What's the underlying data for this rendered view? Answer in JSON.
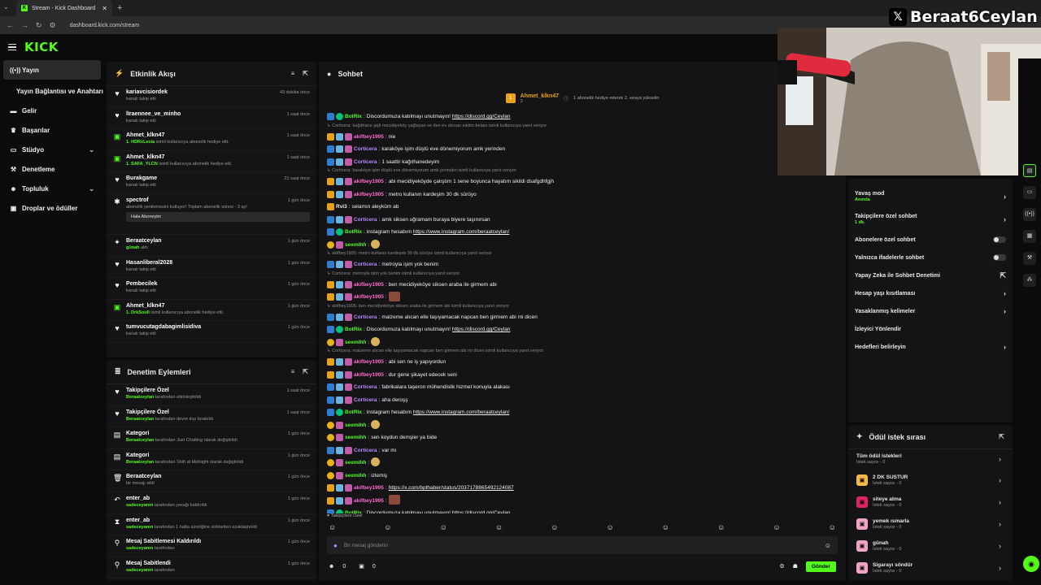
{
  "browser": {
    "tab_title": "Stream - Kick Dashboard",
    "url": "dashboard.kick.com/stream"
  },
  "brand": {
    "logo": "KICK",
    "accent": "#53fc18"
  },
  "overlay": {
    "x_handle": "Beraat6Ceylan"
  },
  "sidebar": {
    "items": [
      {
        "label": "Yayın",
        "icon": "broadcast-icon"
      },
      {
        "label": "Yayın Bağlantısı ve Anahtarı",
        "icon": ""
      },
      {
        "label": "Gelir",
        "icon": "money-icon"
      },
      {
        "label": "Başarılar",
        "icon": "trophy-icon"
      },
      {
        "label": "Stüdyo",
        "icon": "monitor-icon"
      },
      {
        "label": "Denetleme",
        "icon": "hammer-icon"
      },
      {
        "label": "Topluluk",
        "icon": "users-icon"
      },
      {
        "label": "Droplar ve ödüller",
        "icon": "gift-icon"
      }
    ]
  },
  "activity": {
    "title": "Etkinlik Akışı",
    "items": [
      {
        "name": "kariavcisiordek",
        "sub": "kanalı takip etti",
        "time": "43 dakika önce",
        "icon": "heart"
      },
      {
        "name": "lIraennee_ve_minho",
        "sub": "kanalı takip etti",
        "time": "1 saat önce",
        "icon": "heart"
      },
      {
        "name": "Ahmet_klkn47",
        "sub_user": "1. HDRxLexia",
        "sub": "isimli kullanıcıya abonelik hediye etti.",
        "time": "1 saat önce",
        "icon": "gift"
      },
      {
        "name": "Ahmet_klkn47",
        "sub_user": "1. SAFA_YLCN",
        "sub": "isimli kullanıcıya abonelik hediye etti.",
        "time": "1 saat önce",
        "icon": "gift"
      },
      {
        "name": "Burakgame",
        "sub": "kanalı takip etti",
        "time": "21 saat önce",
        "icon": "heart"
      },
      {
        "name": "spectrof",
        "sub": "abonelik yenilemesini kutluyor! Toplam abonelik süresi - 3 ay!",
        "time": "1 gün önce",
        "icon": "star",
        "button": "Hala Aboneyim"
      },
      {
        "name": "Beraatceylan",
        "sub_user": "günah",
        "sub": "aldı",
        "time": "1 gün önce",
        "icon": "reward"
      },
      {
        "name": "Hasanliberal2028",
        "sub": "kanalı takip etti",
        "time": "1 gün önce",
        "icon": "heart"
      },
      {
        "name": "Pembecilek",
        "sub": "kanalı takip etti",
        "time": "1 gün önce",
        "icon": "heart"
      },
      {
        "name": "Ahmet_klkn47",
        "sub_user": "1. DrkSoull",
        "sub": "isimli kullanıcıya abonelik hediye etti.",
        "time": "1 gün önce",
        "icon": "gift"
      },
      {
        "name": "tumvucutagdabagimlisidiva",
        "sub": "kanalı takip etti",
        "time": "1 gün önce",
        "icon": "heart"
      }
    ]
  },
  "moderation": {
    "title": "Denetim Eylemleri",
    "items": [
      {
        "name": "Takipçilere Özel",
        "sub_user": "Beraatceylan",
        "sub": "tarafından etkinleştirildi",
        "time": "1 saat önce",
        "icon": "heart"
      },
      {
        "name": "Takipçilere Özel",
        "sub_user": "Beraatceylan",
        "sub": "tarafından devre dışı bırakıldı",
        "time": "1 saat önce",
        "icon": "heart"
      },
      {
        "name": "Kategori",
        "sub_user": "Beraatceylan",
        "sub": "tarafından Just Chatting olarak değiştirildi",
        "time": "1 gün önce",
        "icon": "category"
      },
      {
        "name": "Kategori",
        "sub_user": "Beraatceylan",
        "sub": "tarafından Shift at Midnight olarak değiştirildi",
        "time": "1 gün önce",
        "icon": "category"
      },
      {
        "name": "Beraatceylan",
        "sub": "bir mesajı sildi",
        "time": "1 gün önce",
        "icon": "trash"
      },
      {
        "name": "enter_ab",
        "sub_user": "sadeceyaren",
        "sub": "tarafından yasağı kaldırıldı",
        "time": "1 gün önce",
        "icon": "undo"
      },
      {
        "name": "enter_ab",
        "sub_user": "sadeceyaren",
        "sub": "tarafından 1 hafta süreliğine sohbetten uzaklaştırıldı",
        "time": "1 gün önce",
        "icon": "hourglass"
      },
      {
        "name": "Mesaj Sabitlemesi Kaldırıldı",
        "sub_user": "sadeceyaren",
        "sub": "tarafından",
        "time": "1 gün önce",
        "icon": "pin"
      },
      {
        "name": "Mesaj Sabitlendi",
        "sub_user": "sadeceyaren",
        "sub": "tarafından",
        "time": "1 gün önce",
        "icon": "pin"
      }
    ]
  },
  "chat": {
    "title": "Sohbet",
    "gift_banner": {
      "user": "Ahmet_klkn47",
      "count": "3",
      "text": "1 abonelik hediye ederek 2. sıraya yükselin"
    },
    "messages": [
      {
        "type": "msg",
        "badges": [
          "b-blue",
          "b-green"
        ],
        "user": "BotRix",
        "ucls": "u-green",
        "text": "Discordumuza katılmayı unutmayın!",
        "link": "https://discord.gg/Ceylan"
      },
      {
        "type": "reply",
        "text": "Corticera: kağıthane şişli mecidiyeköy çağlayan ve den ev alırsan sıktim belanı isimli kullanıcıya yanıt veriyor"
      },
      {
        "type": "msg",
        "badges": [
          "b-gold",
          "b-ice",
          "b-pink"
        ],
        "user": "akifbey1905",
        "ucls": "u-pink",
        "text": "nie"
      },
      {
        "type": "msg",
        "badges": [
          "b-blue",
          "b-ice",
          "b-pink"
        ],
        "user": "Corticera",
        "ucls": "u-violet",
        "text": "karaköye işim düştü eve dönemiyorum amk yerinden"
      },
      {
        "type": "msg",
        "badges": [
          "b-blue",
          "b-ice",
          "b-pink"
        ],
        "user": "Corticera",
        "ucls": "u-violet",
        "text": "1 saattir kağıthanedeyim"
      },
      {
        "type": "reply",
        "text": "Corticera: karaköye işim düştü eve dönemiyorum amk yerinden isimli kullanıcıya yanıt veriyor"
      },
      {
        "type": "msg",
        "badges": [
          "b-gold",
          "b-ice",
          "b-pink"
        ],
        "user": "akifbey1905",
        "ucls": "u-pink",
        "text": "abi mecidiyeköyde çalıştım 1 sene boyunca hayatım sikildi dsafgdhfgjh"
      },
      {
        "type": "msg",
        "badges": [
          "b-gold",
          "b-ice",
          "b-pink"
        ],
        "user": "akifbey1905",
        "ucls": "u-pink",
        "text": "metro kullanın kardeşim 30 dk sürüyo"
      },
      {
        "type": "msg",
        "badges": [
          "b-gold"
        ],
        "user": "Rvi3",
        "ucls": "",
        "text": "selamın aleyküm ab"
      },
      {
        "type": "msg",
        "badges": [
          "b-blue",
          "b-ice",
          "b-pink"
        ],
        "user": "Corticera",
        "ucls": "u-violet",
        "text": "amk siksen uğramam buraya biyere taşınırsan"
      },
      {
        "type": "msg",
        "badges": [
          "b-blue",
          "b-green"
        ],
        "user": "BotRix",
        "ucls": "u-green",
        "text": "instagram hesabım",
        "link": "https://www.instagram.com/beraatceylan/"
      },
      {
        "type": "msg",
        "badges": [
          "b-yellow",
          "b-pink"
        ],
        "user": "seemihh",
        "ucls": "u-green",
        "text": "",
        "emote": "emote"
      },
      {
        "type": "reply",
        "text": "akifbey1905: metro kullanın kardeşim 30 dk sürüyo isimli kullanıcıya yanıt veriyor"
      },
      {
        "type": "msg",
        "badges": [
          "b-blue",
          "b-ice",
          "b-pink"
        ],
        "user": "Corticera",
        "ucls": "u-violet",
        "text": "metroyla işim yok benim"
      },
      {
        "type": "reply",
        "text": "Corticera: metroyla işim yok benim isimli kullanıcıya yanıt veriyor"
      },
      {
        "type": "msg",
        "badges": [
          "b-gold",
          "b-ice",
          "b-pink"
        ],
        "user": "akifbey1905",
        "ucls": "u-pink",
        "text": "ben mecidiyeköye siksen araba ile girmem abi"
      },
      {
        "type": "msg",
        "badges": [
          "b-gold",
          "b-ice",
          "b-pink"
        ],
        "user": "akifbey1905",
        "ucls": "u-pink",
        "text": "",
        "emote": "img"
      },
      {
        "type": "reply",
        "text": "akifbey1905: ben mecidiyeköye siksen araba ile girmem abi isimli kullanıcıya yanıt veriyor"
      },
      {
        "type": "msg",
        "badges": [
          "b-blue",
          "b-ice",
          "b-pink"
        ],
        "user": "Corticera",
        "ucls": "u-violet",
        "text": "malzeme alıcan elle taşıyamacak napcan ben girmem abi mi dicen"
      },
      {
        "type": "msg",
        "badges": [
          "b-blue",
          "b-green"
        ],
        "user": "BotRix",
        "ucls": "u-green",
        "text": "Discordumuza katılmayı unutmayın!",
        "link": "https://discord.gg/Ceylan"
      },
      {
        "type": "msg",
        "badges": [
          "b-yellow",
          "b-pink"
        ],
        "user": "seemihh",
        "ucls": "u-green",
        "text": "",
        "emote": "emote"
      },
      {
        "type": "reply",
        "text": "Corticera: malzeme alıcan elle taşıyamacak napcan ben girmem abi mi dicen isimli kullanıcıya yanıt veriyor"
      },
      {
        "type": "msg",
        "badges": [
          "b-gold",
          "b-ice",
          "b-pink"
        ],
        "user": "akifbey1905",
        "ucls": "u-pink",
        "text": "abi sen ne iş yapıyordun"
      },
      {
        "type": "msg",
        "badges": [
          "b-gold",
          "b-ice",
          "b-pink"
        ],
        "user": "akifbey1905",
        "ucls": "u-pink",
        "text": "dur gene şikayet edecek seni"
      },
      {
        "type": "msg",
        "badges": [
          "b-blue",
          "b-ice",
          "b-pink"
        ],
        "user": "Corticera",
        "ucls": "u-violet",
        "text": "fabrikalara taşeron mühendislik hizmet konuyla alakası"
      },
      {
        "type": "msg",
        "badges": [
          "b-blue",
          "b-ice",
          "b-pink"
        ],
        "user": "Corticera",
        "ucls": "u-violet",
        "text": "aha deroşş"
      },
      {
        "type": "msg",
        "badges": [
          "b-blue",
          "b-green"
        ],
        "user": "BotRix",
        "ucls": "u-green",
        "text": "instagram hesabım",
        "link": "https://www.instagram.com/beraatceylan/"
      },
      {
        "type": "msg",
        "badges": [
          "b-yellow",
          "b-pink"
        ],
        "user": "seemihh",
        "ucls": "u-green",
        "text": "",
        "emote": "emote"
      },
      {
        "type": "msg",
        "badges": [
          "b-yellow",
          "b-pink"
        ],
        "user": "seemihh",
        "ucls": "u-green",
        "text": "sen koydun demşler ya bide"
      },
      {
        "type": "msg",
        "badges": [
          "b-blue",
          "b-ice",
          "b-pink"
        ],
        "user": "Corticera",
        "ucls": "u-violet",
        "text": "var mı"
      },
      {
        "type": "msg",
        "badges": [
          "b-yellow",
          "b-pink"
        ],
        "user": "seemihh",
        "ucls": "u-green",
        "text": "",
        "emote": "emote"
      },
      {
        "type": "msg",
        "badges": [
          "b-yellow",
          "b-pink"
        ],
        "user": "seemihh",
        "ucls": "u-green",
        "text": "izlemiş"
      },
      {
        "type": "msg",
        "badges": [
          "b-gold",
          "b-ice",
          "b-pink"
        ],
        "user": "akifbey1905",
        "ucls": "u-pink",
        "text": "",
        "link": "https://x.com/bpthaber/status/2037178865492124087"
      },
      {
        "type": "msg",
        "badges": [
          "b-gold",
          "b-ice",
          "b-pink"
        ],
        "user": "akifbey1905",
        "ucls": "u-pink",
        "text": "",
        "emote": "img"
      },
      {
        "type": "msg",
        "badges": [
          "b-blue",
          "b-green"
        ],
        "user": "BotRix",
        "ucls": "u-green",
        "text": "Discordumuza katılmayı unutmayın!",
        "link": "https://discord.gg/Ceylan"
      }
    ],
    "followers_only": "Takipçilere Özel",
    "input_placeholder": "Bir mesaj gönderin",
    "viewers": "0",
    "points": "0",
    "send": "Gönder"
  },
  "settings": {
    "items": [
      {
        "label": "Yavaş mod",
        "value": "Anında",
        "control": "chevron"
      },
      {
        "label": "Takipçilere özel sohbet",
        "value": "1 dk.",
        "control": "chevron"
      },
      {
        "label": "Abonelere özel sohbet",
        "value": "",
        "control": "toggle"
      },
      {
        "label": "Yalnızca ifadelerle sohbet",
        "value": "",
        "control": "toggle"
      },
      {
        "label": "Yapay Zeka ile Sohbet Denetimi",
        "value": "",
        "control": "external"
      },
      {
        "label": "Hesap yaşı kısıtlaması",
        "value": "",
        "control": "chevron"
      },
      {
        "label": "Yasaklanmış kelimeler",
        "value": "",
        "control": "chevron"
      },
      {
        "label": "İzleyici Yönlendir",
        "value": "",
        "control": "none"
      },
      {
        "label": "Hedefleri belirleyin",
        "value": "",
        "control": "chevron"
      }
    ]
  },
  "rewards": {
    "title": "Ödül istek sırası",
    "all": {
      "label": "Tüm ödül istekleri",
      "sub": "İstek sayısı - 0"
    },
    "items": [
      {
        "label": "2 DK SUSTUR",
        "sub": "İstek sayısı - 0",
        "color": "#f5b94a"
      },
      {
        "label": "siteye atma",
        "sub": "İstek sayısı - 0",
        "color": "#e0245e"
      },
      {
        "label": "yemek ısmarla",
        "sub": "İstek sayısı - 0",
        "color": "#f0a3c4"
      },
      {
        "label": "günah",
        "sub": "İstek sayısı - 0",
        "color": "#f0a3c4"
      },
      {
        "label": "Sigarayı söndür",
        "sub": "İstek sayısı - 0",
        "color": "#f0a3c4"
      }
    ]
  }
}
